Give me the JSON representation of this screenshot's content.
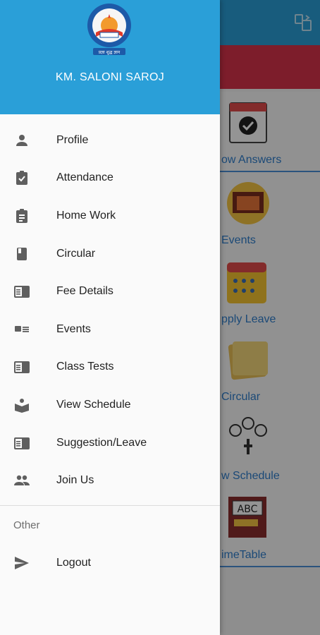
{
  "background": {
    "tiles": [
      {
        "label": "ow Answers"
      },
      {
        "label": "Events"
      },
      {
        "label": "pply Leave"
      },
      {
        "label": "Circular"
      },
      {
        "label": "w Schedule"
      },
      {
        "label": "imeTable"
      }
    ],
    "timetable_art_text": "ABC"
  },
  "drawer": {
    "user_name": "KM. SALONI SAROJ",
    "logo_motto": "प्रज्ञा शुद्ध ज्ञान",
    "menu_items": [
      {
        "label": "Profile",
        "icon": "person-icon"
      },
      {
        "label": "Attendance",
        "icon": "assignment-turned-in-icon"
      },
      {
        "label": "Home Work",
        "icon": "assignment-icon"
      },
      {
        "label": "Circular",
        "icon": "book-icon"
      },
      {
        "label": "Fee Details",
        "icon": "chrome-reader-mode-icon"
      },
      {
        "label": "Events",
        "icon": "featured-play-list-icon"
      },
      {
        "label": "Class Tests",
        "icon": "chrome-reader-mode-icon"
      },
      {
        "label": "View Schedule",
        "icon": "local-library-icon"
      },
      {
        "label": "Suggestion/Leave",
        "icon": "chrome-reader-mode-icon"
      },
      {
        "label": "Join Us",
        "icon": "people-icon"
      }
    ],
    "other_section_label": "Other",
    "logout_label": "Logout"
  },
  "colors": {
    "header_blue": "#2a9fd8",
    "banner_red": "#d8334a",
    "tile_label_blue": "#2f7fce",
    "icon_gray": "#5f5f5f"
  }
}
